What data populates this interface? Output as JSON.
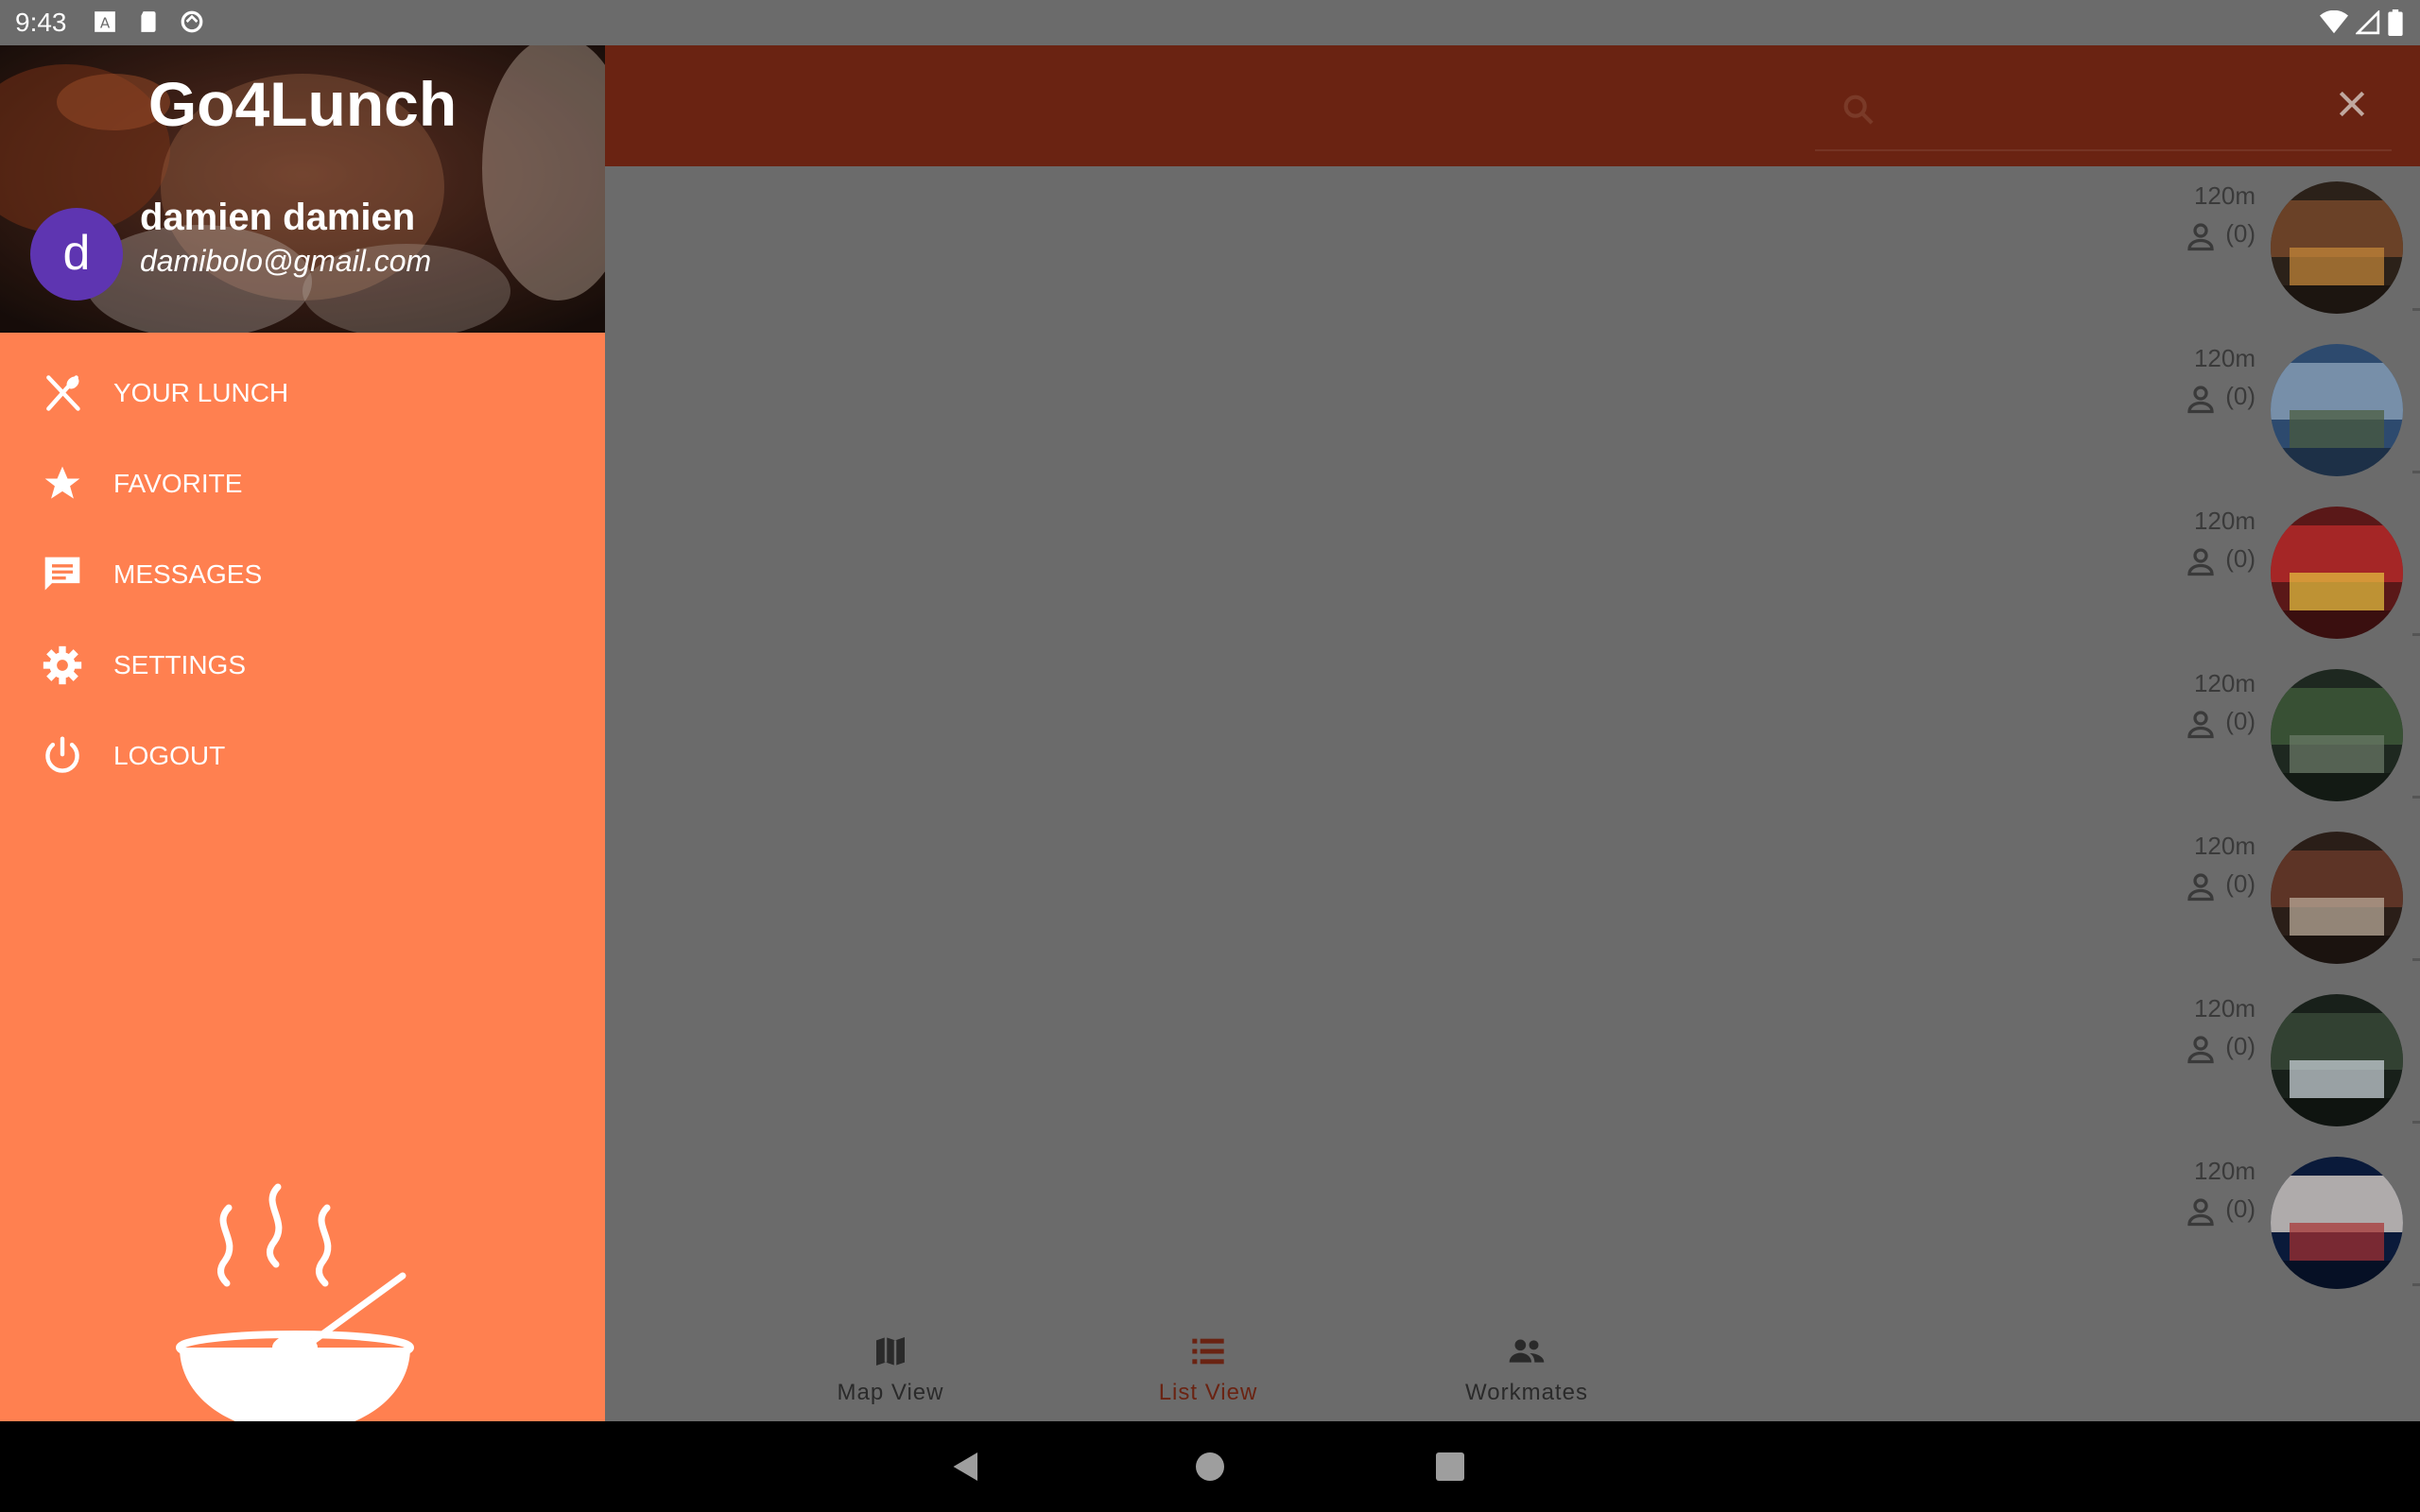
{
  "status_bar": {
    "time": "9:43"
  },
  "drawer": {
    "app_title": "Go4Lunch",
    "user": {
      "initial": "d",
      "name": "damien damien",
      "email": "damibolo@gmail.com"
    },
    "menu": [
      {
        "label": "YOUR LUNCH",
        "icon": "cutlery-icon"
      },
      {
        "label": "FAVORITE",
        "icon": "star-icon"
      },
      {
        "label": "MESSAGES",
        "icon": "message-icon"
      },
      {
        "label": "SETTINGS",
        "icon": "gear-icon"
      },
      {
        "label": "LOGOUT",
        "icon": "power-icon"
      }
    ]
  },
  "restaurants": [
    {
      "distance": "120m",
      "workmates": "(0)"
    },
    {
      "distance": "120m",
      "workmates": "(0)"
    },
    {
      "distance": "120m",
      "workmates": "(0)"
    },
    {
      "distance": "120m",
      "workmates": "(0)"
    },
    {
      "distance": "120m",
      "workmates": "(0)"
    },
    {
      "distance": "120m",
      "workmates": "(0)"
    },
    {
      "distance": "120m",
      "workmates": "(0)"
    }
  ],
  "bottom_nav": [
    {
      "label": "Map View",
      "icon": "map-icon",
      "active": false
    },
    {
      "label": "List View",
      "icon": "list-icon",
      "active": true
    },
    {
      "label": "Workmates",
      "icon": "people-icon",
      "active": false
    }
  ],
  "colors": {
    "toolbar": "#6a2312",
    "drawer_background": "#ff8050",
    "avatar": "#5e35b1",
    "active_tab": "#6a2312"
  }
}
